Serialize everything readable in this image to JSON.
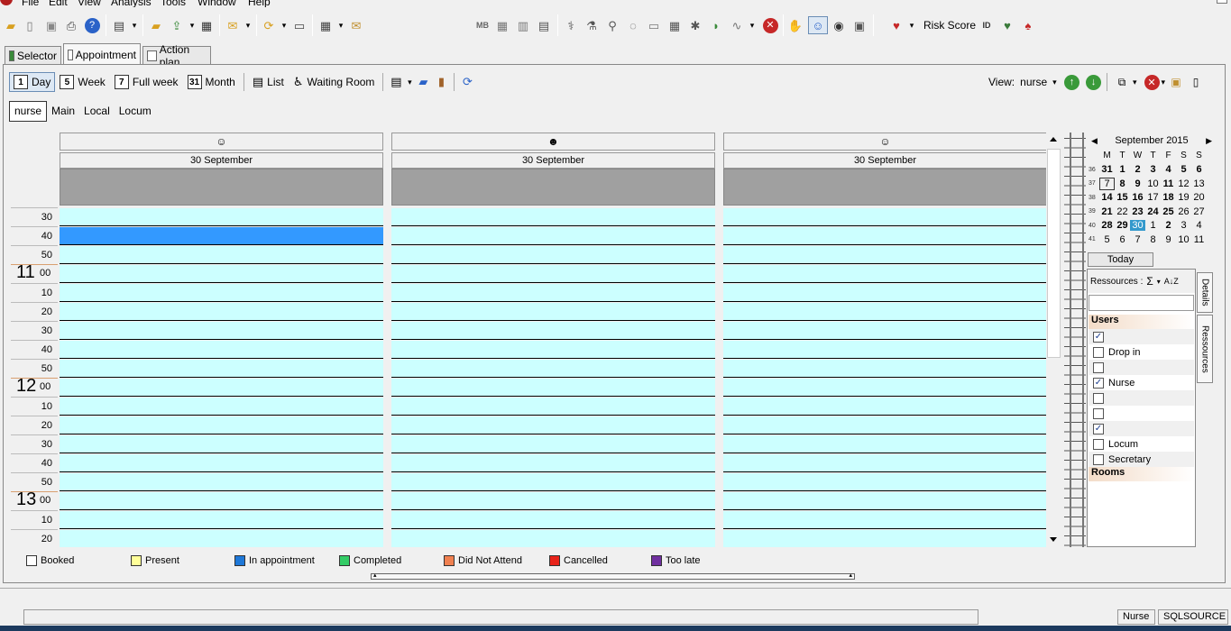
{
  "menu": {
    "items": [
      "File",
      "Edit",
      "View",
      "Analysis",
      "Tools",
      "Window",
      "Help"
    ]
  },
  "toolbar": {
    "icons": [
      "open-folder-icon",
      "new-doc-icon",
      "save-icon",
      "print-icon",
      "help-icon",
      "report-icon",
      "folder-up-icon",
      "export-icon",
      "list-icon",
      "envelope-icon",
      "refresh-icon",
      "window-icon",
      "table-icon",
      "mail-icon",
      "grid-icon",
      "bar-chart-icon",
      "table-view-icon",
      "stethoscope-icon",
      "flask-icon",
      "lab-icon",
      "pills-icon",
      "folder-icon",
      "calendar-icon",
      "bug-icon",
      "wave-chart-icon",
      "stop-icon",
      "hand-icon",
      "people-icon",
      "eye-icon",
      "device-icon",
      "heart-icon",
      "id-icon",
      "heart-sign-icon",
      "lungs-icon"
    ],
    "mb_label": "MB",
    "risk_score_label": "Risk Score"
  },
  "tabs": [
    {
      "label": "Selector",
      "active": false
    },
    {
      "label": "Appointment",
      "active": true
    },
    {
      "label": "Action plan",
      "active": false
    }
  ],
  "views": [
    {
      "icon_text": "1",
      "label": "Day",
      "active": true
    },
    {
      "icon_text": "5",
      "label": "Week",
      "active": false
    },
    {
      "icon_text": "7",
      "label": "Full week",
      "active": false
    },
    {
      "icon_text": "31",
      "label": "Month",
      "active": false
    },
    {
      "icon_text": "",
      "label": "List",
      "active": false
    },
    {
      "icon_text": "",
      "label": "Waiting Room",
      "active": false
    }
  ],
  "view_selector": {
    "label": "View:",
    "value": "nurse"
  },
  "subtabs": [
    {
      "label": "nurse",
      "active": true
    },
    {
      "label": "Main",
      "active": false
    },
    {
      "label": "Local",
      "active": false
    },
    {
      "label": "Locum",
      "active": false
    }
  ],
  "columns": [
    {
      "icon": "nurse-icon",
      "date": "30 September",
      "selected_slot": 1
    },
    {
      "icon": "doctor-icon",
      "date": "30 September",
      "selected_slot": -1
    },
    {
      "icon": "person-icon",
      "date": "30 September",
      "selected_slot": -1
    }
  ],
  "timeslots": [
    {
      "min": "30"
    },
    {
      "min": "40"
    },
    {
      "min": "50"
    },
    {
      "hour": "11",
      "min": "00"
    },
    {
      "min": "10"
    },
    {
      "min": "20"
    },
    {
      "min": "30"
    },
    {
      "min": "40"
    },
    {
      "min": "50"
    },
    {
      "hour": "12",
      "min": "00"
    },
    {
      "min": "10"
    },
    {
      "min": "20"
    },
    {
      "min": "30"
    },
    {
      "min": "40"
    },
    {
      "min": "50"
    },
    {
      "hour": "13",
      "min": "00"
    },
    {
      "min": "10"
    },
    {
      "min": "20"
    }
  ],
  "minical": {
    "title": "September 2015",
    "dow": [
      "M",
      "T",
      "W",
      "T",
      "F",
      "S",
      "S"
    ],
    "weeks": [
      {
        "wk": "36",
        "days": [
          {
            "d": "31",
            "b": true
          },
          {
            "d": "1",
            "b": true
          },
          {
            "d": "2",
            "b": true
          },
          {
            "d": "3",
            "b": true
          },
          {
            "d": "4",
            "b": true
          },
          {
            "d": "5",
            "b": true
          },
          {
            "d": "6",
            "b": true
          }
        ]
      },
      {
        "wk": "37",
        "days": [
          {
            "d": "7",
            "b": false,
            "today": true
          },
          {
            "d": "8",
            "b": true
          },
          {
            "d": "9",
            "b": true
          },
          {
            "d": "10",
            "b": false
          },
          {
            "d": "11",
            "b": true
          },
          {
            "d": "12",
            "b": false
          },
          {
            "d": "13",
            "b": false
          }
        ]
      },
      {
        "wk": "38",
        "days": [
          {
            "d": "14",
            "b": true
          },
          {
            "d": "15",
            "b": true
          },
          {
            "d": "16",
            "b": true
          },
          {
            "d": "17",
            "b": false
          },
          {
            "d": "18",
            "b": true
          },
          {
            "d": "19",
            "b": false
          },
          {
            "d": "20",
            "b": false
          }
        ]
      },
      {
        "wk": "39",
        "days": [
          {
            "d": "21",
            "b": true
          },
          {
            "d": "22",
            "b": false
          },
          {
            "d": "23",
            "b": true
          },
          {
            "d": "24",
            "b": true
          },
          {
            "d": "25",
            "b": true
          },
          {
            "d": "26",
            "b": false
          },
          {
            "d": "27",
            "b": false
          }
        ]
      },
      {
        "wk": "40",
        "days": [
          {
            "d": "28",
            "b": true
          },
          {
            "d": "29",
            "b": true
          },
          {
            "d": "30",
            "b": false,
            "sel": true
          },
          {
            "d": "1",
            "b": false
          },
          {
            "d": "2",
            "b": true
          },
          {
            "d": "3",
            "b": false
          },
          {
            "d": "4",
            "b": false
          }
        ]
      },
      {
        "wk": "41",
        "days": [
          {
            "d": "5",
            "b": false
          },
          {
            "d": "6",
            "b": false
          },
          {
            "d": "7",
            "b": false
          },
          {
            "d": "8",
            "b": false
          },
          {
            "d": "9",
            "b": false
          },
          {
            "d": "10",
            "b": false
          },
          {
            "d": "11",
            "b": false
          }
        ]
      }
    ]
  },
  "today_button": "Today",
  "resources": {
    "label": "Ressources :",
    "sum_symbol": "Σ",
    "sort_symbol": "A↓Z",
    "groups": [
      {
        "name": "Users",
        "items": [
          {
            "label": "",
            "checked": true
          },
          {
            "label": "Drop in",
            "checked": false
          },
          {
            "label": "",
            "checked": false
          },
          {
            "label": "Nurse",
            "checked": true
          },
          {
            "label": "",
            "checked": false
          },
          {
            "label": "",
            "checked": false
          },
          {
            "label": "",
            "checked": true
          },
          {
            "label": "Locum",
            "checked": false
          },
          {
            "label": "Secretary",
            "checked": false
          }
        ]
      },
      {
        "name": "Rooms",
        "items": []
      }
    ]
  },
  "side_tabs": {
    "details": "Details",
    "resources": "Ressources"
  },
  "legend": [
    {
      "label": "Booked",
      "color": "#ffffff"
    },
    {
      "label": "Present",
      "color": "#ffff99"
    },
    {
      "label": "In appointment",
      "color": "#1e78d8"
    },
    {
      "label": "Completed",
      "color": "#33cc66"
    },
    {
      "label": "Did Not Attend",
      "color": "#f08050"
    },
    {
      "label": "Cancelled",
      "color": "#e8231a"
    },
    {
      "label": "Too late",
      "color": "#7030a0"
    }
  ],
  "status": {
    "role": "Nurse",
    "db": "SQLSOURCE"
  },
  "colors": {
    "slot": "#ccffff",
    "selected_slot": "#3399ff",
    "header_gray": "#a0a0a0"
  }
}
